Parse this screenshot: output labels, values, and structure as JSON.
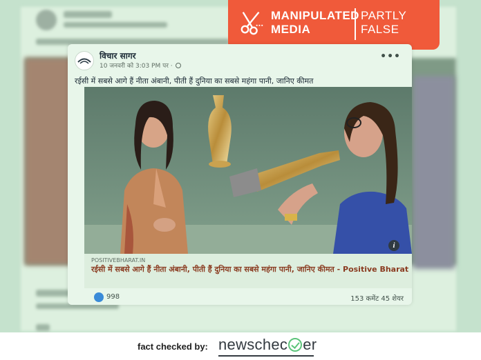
{
  "verdict": {
    "line1": "MANIPULATED",
    "line2": "MEDIA",
    "line3": "PARTLY",
    "line4": "FALSE",
    "color": "#f05a3a",
    "icon": "scissors-icon"
  },
  "post": {
    "page_name": "विचार सागर",
    "timestamp": "10 जनवरी को 3:03 PM पर",
    "text": "रईसी में सबसे आगे हैं नीता अंबानी, पीती हैं दुनिया का सबसे महंगा पानी, जानिए कीमत",
    "more_icon": "more-dots-icon",
    "link": {
      "domain": "POSITIVEBHARAT.IN",
      "title": "रईसी में सबसे आगे हैं नीता अंबानी, पीती हैं दुनिया का सबसे महंगा पानी, जानिए कीमत - Positive Bharat"
    },
    "reactions": "998",
    "comments_shares": "153 कमेंट  45 शेयर",
    "info_label": "i"
  },
  "footer": {
    "label": "fact checked by:",
    "brand_before": "newschec",
    "brand_after": "er",
    "brand_color": "#5cc47a"
  },
  "colors": {
    "overlay_tint": "#c5e2cd",
    "link_title": "#8a3b20",
    "like_blue": "#3a8bd8"
  }
}
